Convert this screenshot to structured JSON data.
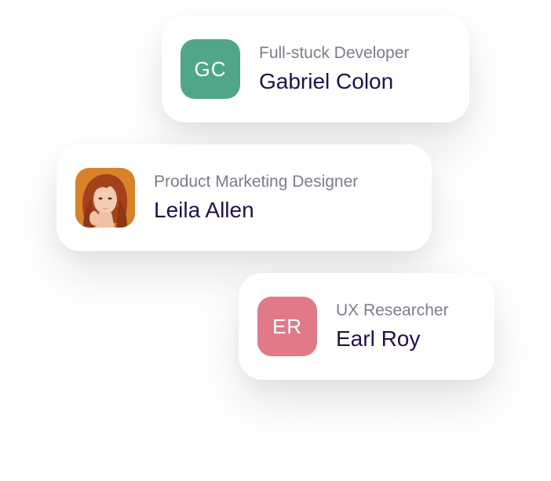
{
  "cards": [
    {
      "initials": "GC",
      "avatar_color": "#4fa68a",
      "role": "Full-stuck Developer",
      "name": "Gabriel Colon"
    },
    {
      "avatar_kind": "photo",
      "role": "Product Marketing Designer",
      "name": "Leila Allen"
    },
    {
      "initials": "ER",
      "avatar_color": "#e07a89",
      "role": "UX Researcher",
      "name": "Earl Roy"
    }
  ],
  "colors": {
    "name_text": "#22104a",
    "role_text": "#7d7d8a",
    "card_background": "#ffffff"
  }
}
